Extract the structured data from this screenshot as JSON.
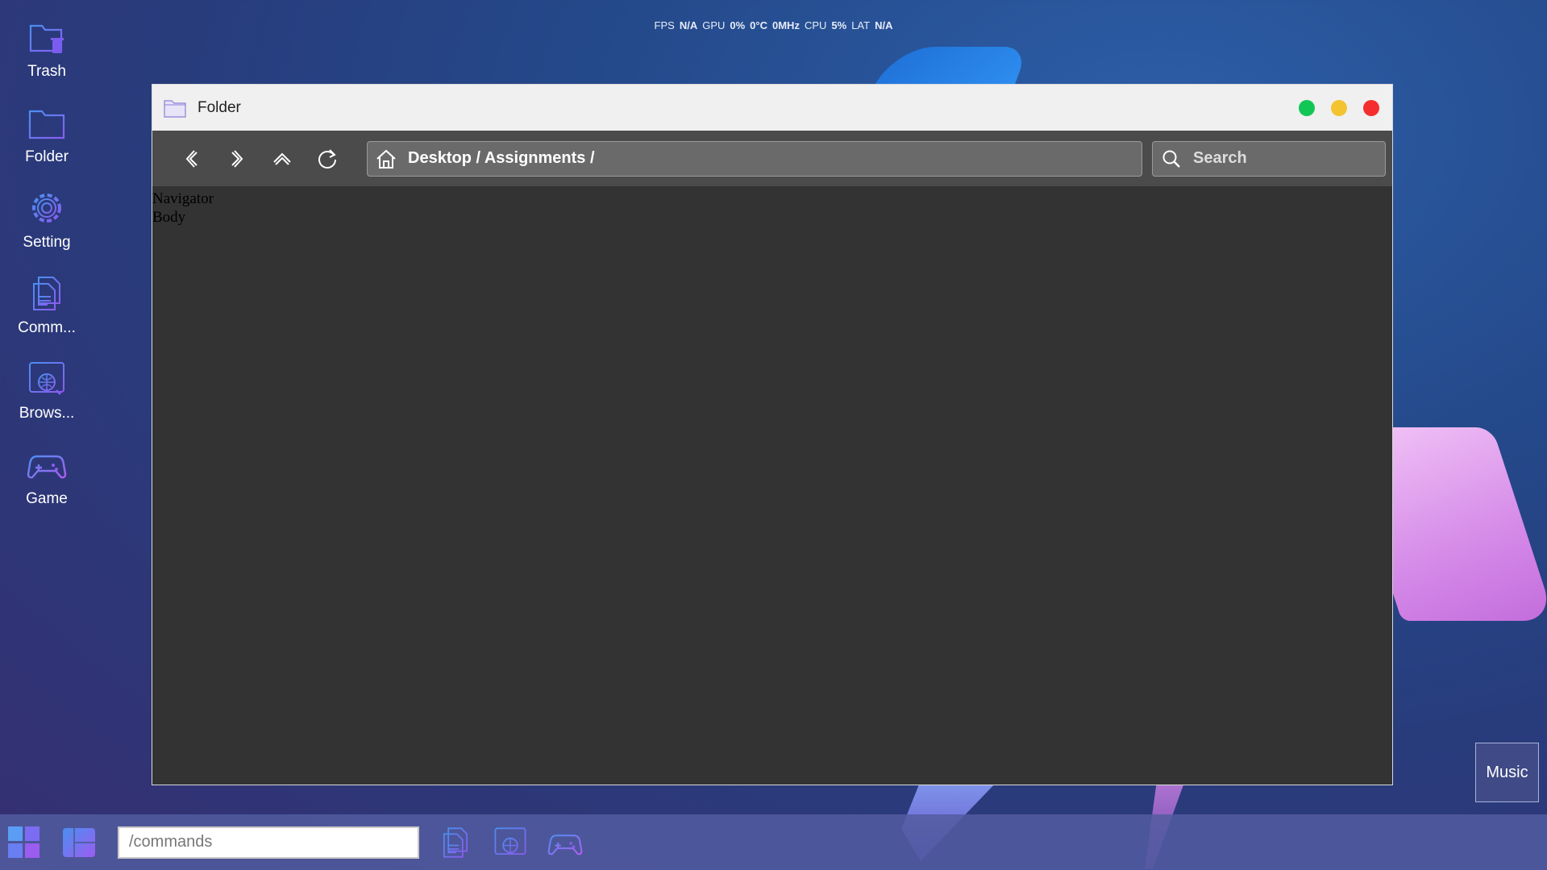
{
  "status_bar": {
    "fps_label": "FPS",
    "fps_value": "N/A",
    "gpu_label": "GPU",
    "gpu_util": "0%",
    "gpu_temp": "0°C",
    "gpu_clock": "0MHz",
    "cpu_label": "CPU",
    "cpu_util": "5%",
    "lat_label": "LAT",
    "lat_value": "N/A"
  },
  "desktop_icons": [
    {
      "label": "Trash",
      "icon": "trash-folder-icon"
    },
    {
      "label": "Folder",
      "icon": "folder-icon"
    },
    {
      "label": "Setting",
      "icon": "gear-icon"
    },
    {
      "label": "Comm...",
      "icon": "document-icon"
    },
    {
      "label": "Brows...",
      "icon": "browser-globe-icon"
    },
    {
      "label": "Game",
      "icon": "gamepad-icon"
    }
  ],
  "window": {
    "title": "Folder",
    "path": "Desktop / Assignments /",
    "search_placeholder": "Search",
    "body_lines": [
      "Navigator",
      "Body"
    ]
  },
  "music": {
    "label": "Music"
  },
  "taskbar": {
    "command_placeholder": "/commands"
  },
  "colors": {
    "accent_purple": "#7b5cf0",
    "accent_blue": "#4a8ff0",
    "window_body": "#333333",
    "toolbar": "#4b4b4b",
    "close": "#f42e2e",
    "minimize": "#f4c430",
    "maximize": "#12c656"
  }
}
